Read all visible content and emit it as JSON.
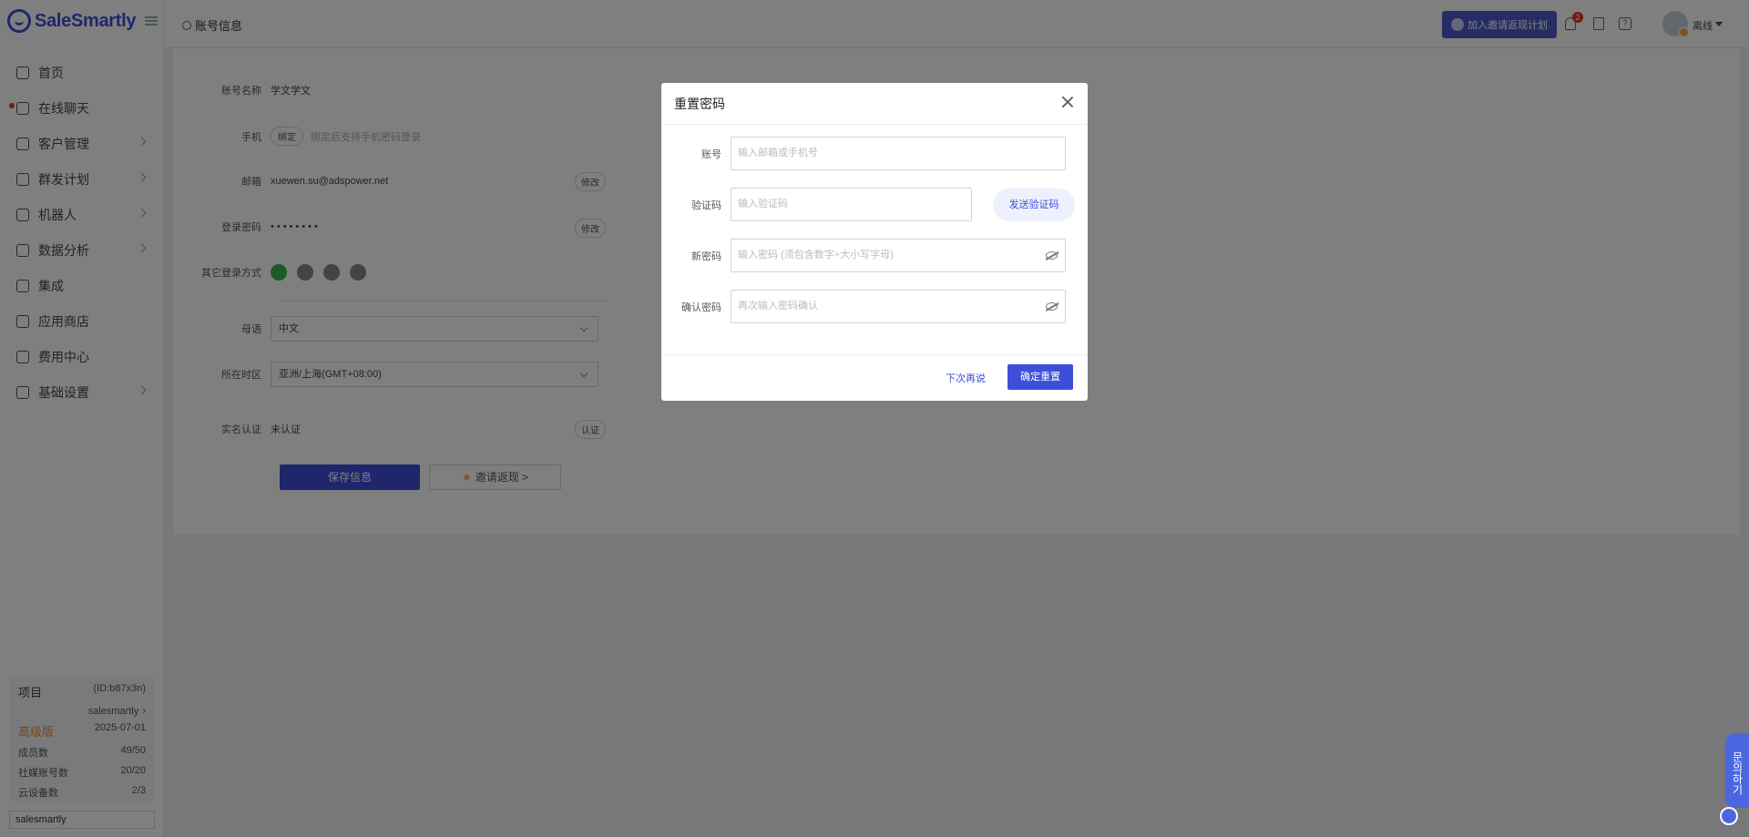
{
  "sidebar": {
    "logo": "SaleSmartly",
    "items": [
      {
        "label": "首页",
        "icon": "home-icon",
        "has_chevron": false,
        "dot": false
      },
      {
        "label": "在线聊天",
        "icon": "chat-icon",
        "has_chevron": false,
        "dot": true
      },
      {
        "label": "客户管理",
        "icon": "users-icon",
        "has_chevron": true,
        "dot": false
      },
      {
        "label": "群发计划",
        "icon": "send-icon",
        "has_chevron": true,
        "dot": false
      },
      {
        "label": "机器人",
        "icon": "robot-icon",
        "has_chevron": true,
        "dot": false
      },
      {
        "label": "数据分析",
        "icon": "chart-icon",
        "has_chevron": true,
        "dot": false
      },
      {
        "label": "集成",
        "icon": "integration-icon",
        "has_chevron": false,
        "dot": false
      },
      {
        "label": "应用商店",
        "icon": "apps-icon",
        "has_chevron": false,
        "dot": false
      },
      {
        "label": "费用中心",
        "icon": "wallet-icon",
        "has_chevron": false,
        "dot": false
      },
      {
        "label": "基础设置",
        "icon": "gear-icon",
        "has_chevron": true,
        "dot": false
      }
    ],
    "project": {
      "title": "项目",
      "id": "(ID:b87x3n)",
      "name": "salesmartly",
      "plan": "高级版",
      "expiry": "2025-07-01",
      "stats": [
        {
          "label": "成员数",
          "value": "49/50"
        },
        {
          "label": "社媒账号数",
          "value": "20/20"
        },
        {
          "label": "云设备数",
          "value": "2/3"
        }
      ]
    },
    "bottom_input": "salesmartly"
  },
  "topbar": {
    "page_title": "账号信息",
    "invite_label": "加入邀请返现计划",
    "notification_count": "2",
    "status": "离线"
  },
  "account": {
    "name_label": "账号名称",
    "name_value": "学文学文",
    "phone_label": "手机",
    "phone_bind": "绑定",
    "phone_hint": "绑定后支持手机密码登录",
    "email_label": "邮箱",
    "email_value": "xuewen.su@adspower.net",
    "edit_label": "修改",
    "password_label": "登录密码",
    "password_value": "••••••••",
    "other_login_label": "其它登录方式",
    "language_label": "母语",
    "language_value": "中文",
    "timezone_label": "所在时区",
    "timezone_value": "亚洲/上海(GMT+08:00)",
    "verify_label": "实名认证",
    "verify_value": "未认证",
    "verify_button": "认证",
    "save_button": "保存信息",
    "invite_button": "邀请返现 >"
  },
  "modal": {
    "title": "重置密码",
    "account_label": "账号",
    "account_placeholder": "输入邮箱或手机号",
    "code_label": "验证码",
    "code_placeholder": "输入验证码",
    "send_code": "发送验证码",
    "new_password_label": "新密码",
    "new_password_placeholder": "输入密码 (须包含数字+大小写字母)",
    "confirm_password_label": "确认密码",
    "confirm_password_placeholder": "再次输入密码确认",
    "later": "下次再说",
    "confirm": "确定重置"
  },
  "chat_widget": {
    "label": "문의하기"
  }
}
